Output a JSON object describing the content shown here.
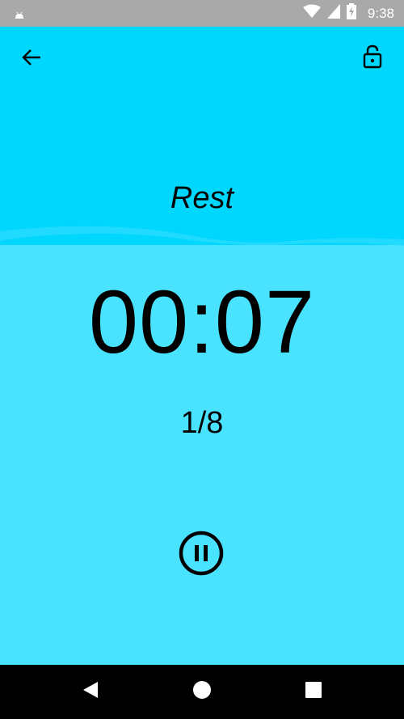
{
  "status_bar": {
    "time": "9:38",
    "icons": [
      "android-icon",
      "wifi-icon",
      "signal-icon",
      "battery-charging-icon"
    ]
  },
  "toolbar": {
    "back_icon": "arrow-back-icon",
    "lock_icon": "lock-open-icon"
  },
  "timer": {
    "phase": "Rest",
    "time": "00:07",
    "round": "1/8"
  },
  "controls": {
    "pause_icon": "pause-circle-icon"
  },
  "nav_bar": {
    "icons": [
      "back-triangle-icon",
      "home-circle-icon",
      "recents-square-icon"
    ]
  },
  "colors": {
    "status_bar": "#a9a9a9",
    "top_background": "#00d7ff",
    "main_background": "#4ae3ff",
    "nav_bar": "#000000"
  }
}
